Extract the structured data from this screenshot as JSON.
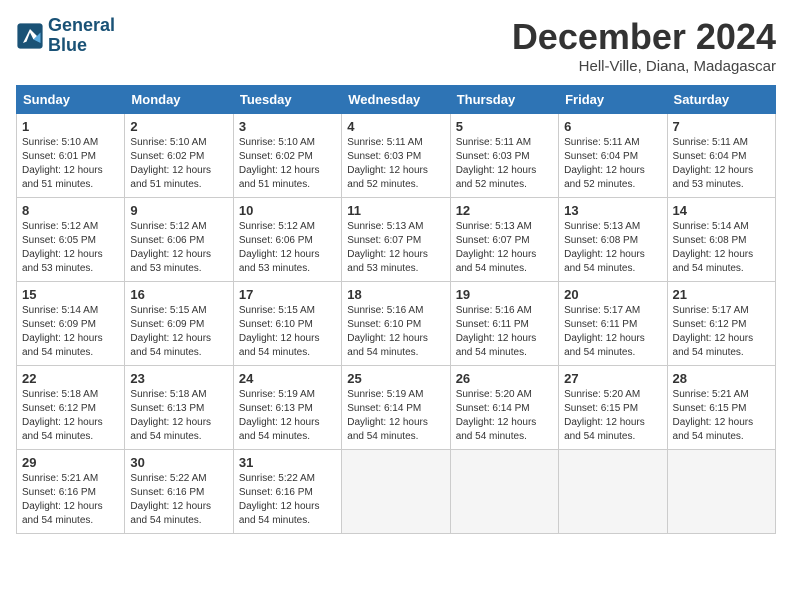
{
  "logo": {
    "line1": "General",
    "line2": "Blue"
  },
  "title": "December 2024",
  "location": "Hell-Ville, Diana, Madagascar",
  "days_of_week": [
    "Sunday",
    "Monday",
    "Tuesday",
    "Wednesday",
    "Thursday",
    "Friday",
    "Saturday"
  ],
  "weeks": [
    [
      {
        "day": "1",
        "info": "Sunrise: 5:10 AM\nSunset: 6:01 PM\nDaylight: 12 hours\nand 51 minutes."
      },
      {
        "day": "2",
        "info": "Sunrise: 5:10 AM\nSunset: 6:02 PM\nDaylight: 12 hours\nand 51 minutes."
      },
      {
        "day": "3",
        "info": "Sunrise: 5:10 AM\nSunset: 6:02 PM\nDaylight: 12 hours\nand 51 minutes."
      },
      {
        "day": "4",
        "info": "Sunrise: 5:11 AM\nSunset: 6:03 PM\nDaylight: 12 hours\nand 52 minutes."
      },
      {
        "day": "5",
        "info": "Sunrise: 5:11 AM\nSunset: 6:03 PM\nDaylight: 12 hours\nand 52 minutes."
      },
      {
        "day": "6",
        "info": "Sunrise: 5:11 AM\nSunset: 6:04 PM\nDaylight: 12 hours\nand 52 minutes."
      },
      {
        "day": "7",
        "info": "Sunrise: 5:11 AM\nSunset: 6:04 PM\nDaylight: 12 hours\nand 53 minutes."
      }
    ],
    [
      {
        "day": "8",
        "info": "Sunrise: 5:12 AM\nSunset: 6:05 PM\nDaylight: 12 hours\nand 53 minutes."
      },
      {
        "day": "9",
        "info": "Sunrise: 5:12 AM\nSunset: 6:06 PM\nDaylight: 12 hours\nand 53 minutes."
      },
      {
        "day": "10",
        "info": "Sunrise: 5:12 AM\nSunset: 6:06 PM\nDaylight: 12 hours\nand 53 minutes."
      },
      {
        "day": "11",
        "info": "Sunrise: 5:13 AM\nSunset: 6:07 PM\nDaylight: 12 hours\nand 53 minutes."
      },
      {
        "day": "12",
        "info": "Sunrise: 5:13 AM\nSunset: 6:07 PM\nDaylight: 12 hours\nand 54 minutes."
      },
      {
        "day": "13",
        "info": "Sunrise: 5:13 AM\nSunset: 6:08 PM\nDaylight: 12 hours\nand 54 minutes."
      },
      {
        "day": "14",
        "info": "Sunrise: 5:14 AM\nSunset: 6:08 PM\nDaylight: 12 hours\nand 54 minutes."
      }
    ],
    [
      {
        "day": "15",
        "info": "Sunrise: 5:14 AM\nSunset: 6:09 PM\nDaylight: 12 hours\nand 54 minutes."
      },
      {
        "day": "16",
        "info": "Sunrise: 5:15 AM\nSunset: 6:09 PM\nDaylight: 12 hours\nand 54 minutes."
      },
      {
        "day": "17",
        "info": "Sunrise: 5:15 AM\nSunset: 6:10 PM\nDaylight: 12 hours\nand 54 minutes."
      },
      {
        "day": "18",
        "info": "Sunrise: 5:16 AM\nSunset: 6:10 PM\nDaylight: 12 hours\nand 54 minutes."
      },
      {
        "day": "19",
        "info": "Sunrise: 5:16 AM\nSunset: 6:11 PM\nDaylight: 12 hours\nand 54 minutes."
      },
      {
        "day": "20",
        "info": "Sunrise: 5:17 AM\nSunset: 6:11 PM\nDaylight: 12 hours\nand 54 minutes."
      },
      {
        "day": "21",
        "info": "Sunrise: 5:17 AM\nSunset: 6:12 PM\nDaylight: 12 hours\nand 54 minutes."
      }
    ],
    [
      {
        "day": "22",
        "info": "Sunrise: 5:18 AM\nSunset: 6:12 PM\nDaylight: 12 hours\nand 54 minutes."
      },
      {
        "day": "23",
        "info": "Sunrise: 5:18 AM\nSunset: 6:13 PM\nDaylight: 12 hours\nand 54 minutes."
      },
      {
        "day": "24",
        "info": "Sunrise: 5:19 AM\nSunset: 6:13 PM\nDaylight: 12 hours\nand 54 minutes."
      },
      {
        "day": "25",
        "info": "Sunrise: 5:19 AM\nSunset: 6:14 PM\nDaylight: 12 hours\nand 54 minutes."
      },
      {
        "day": "26",
        "info": "Sunrise: 5:20 AM\nSunset: 6:14 PM\nDaylight: 12 hours\nand 54 minutes."
      },
      {
        "day": "27",
        "info": "Sunrise: 5:20 AM\nSunset: 6:15 PM\nDaylight: 12 hours\nand 54 minutes."
      },
      {
        "day": "28",
        "info": "Sunrise: 5:21 AM\nSunset: 6:15 PM\nDaylight: 12 hours\nand 54 minutes."
      }
    ],
    [
      {
        "day": "29",
        "info": "Sunrise: 5:21 AM\nSunset: 6:16 PM\nDaylight: 12 hours\nand 54 minutes."
      },
      {
        "day": "30",
        "info": "Sunrise: 5:22 AM\nSunset: 6:16 PM\nDaylight: 12 hours\nand 54 minutes."
      },
      {
        "day": "31",
        "info": "Sunrise: 5:22 AM\nSunset: 6:16 PM\nDaylight: 12 hours\nand 54 minutes."
      },
      {
        "day": "",
        "info": ""
      },
      {
        "day": "",
        "info": ""
      },
      {
        "day": "",
        "info": ""
      },
      {
        "day": "",
        "info": ""
      }
    ]
  ]
}
